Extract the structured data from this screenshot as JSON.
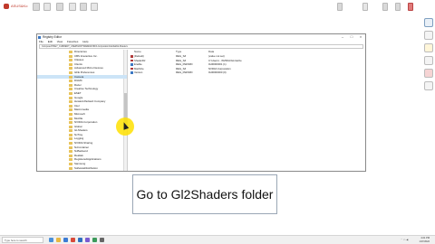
{
  "recorder": {
    "logo_text": "ASUS&Ko"
  },
  "window": {
    "title": "Registry Editor",
    "menu": [
      "File",
      "Edit",
      "View",
      "Favorites",
      "Help"
    ],
    "address": "Computer\\HKEY_CURRENT_USER\\SOFTWARE\\NVIDIA Corporation\\Global\\GLShaders"
  },
  "tree": {
    "items": [
      "Directories",
      "CBS Interactive Inc.",
      "Classes",
      "Clients",
      "Advanced Micro Devices",
      "GFE Preferences",
      "Camera",
      "DGMC",
      "Razer",
      "Creative Technology",
      "ESET",
      "Google",
      "Hewlett-Packard Company",
      "Intel",
      "Macromedia",
      "Microsoft",
      "Mozilla",
      "NVIDIA Corporation",
      "Global",
      "GLShaders",
      "NvTray",
      "Logging",
      "NVIDIA Sharing",
      "NvContainer",
      "NvBackend",
      "Realtek",
      "RegisteredApplications",
      "Samsung",
      "SoftwareDistribution",
      "Synaptics",
      "Valve",
      "Wow6432Node",
      "ZDStudio",
      "System",
      "Volatile Environment"
    ],
    "selected_index": 6
  },
  "values": {
    "headers": [
      "Name",
      "Type",
      "Data"
    ],
    "rows": [
      {
        "name": "(Default)",
        "type": "REG_SZ",
        "data": "(value not set)",
        "kind": "str"
      },
      {
        "name": "ShaderDir",
        "type": "REG_SZ",
        "data": "C:\\Users\\...\\NVIDIA\\GLCache",
        "kind": "str"
      },
      {
        "name": "Enable",
        "type": "REG_DWORD",
        "data": "0x00000001 (1)",
        "kind": "num"
      },
      {
        "name": "MaxSize",
        "type": "REG_SZ",
        "data": "NVIDIA Corporation",
        "kind": "str"
      },
      {
        "name": "Version",
        "type": "REG_DWORD",
        "data": "0x00000000 (0)",
        "kind": "num"
      }
    ]
  },
  "caption": {
    "text": "Go to Gl2Shaders folder"
  },
  "taskbar": {
    "search_placeholder": "Type here to search",
    "time": "4:21 PM",
    "date": "1/17/2022"
  },
  "colors": {
    "caption_border": "#9aa7b5",
    "cursor_highlight": "#ffe100",
    "selection": "#cce4f7"
  }
}
